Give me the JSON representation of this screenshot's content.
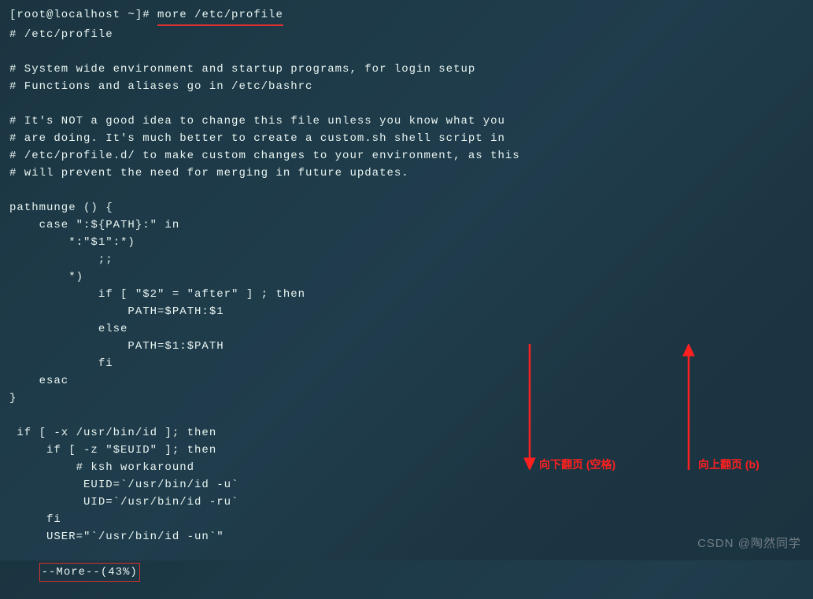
{
  "prompt": {
    "user_host": "[root@localhost ~]# ",
    "command": "more /etc/profile"
  },
  "file_content": {
    "lines": [
      "# /etc/profile",
      "",
      "# System wide environment and startup programs, for login setup",
      "# Functions and aliases go in /etc/bashrc",
      "",
      "# It's NOT a good idea to change this file unless you know what you",
      "# are doing. It's much better to create a custom.sh shell script in",
      "# /etc/profile.d/ to make custom changes to your environment, as this",
      "# will prevent the need for merging in future updates.",
      "",
      "pathmunge () {",
      "    case \":${PATH}:\" in",
      "        *:\"$1\":*)",
      "            ;;",
      "        *)",
      "            if [ \"$2\" = \"after\" ] ; then",
      "                PATH=$PATH:$1",
      "            else",
      "                PATH=$1:$PATH",
      "            fi",
      "    esac",
      "}",
      "",
      " if [ -x /usr/bin/id ]; then",
      "     if [ -z \"$EUID\" ]; then",
      "         # ksh workaround",
      "          EUID=`/usr/bin/id -u`",
      "          UID=`/usr/bin/id -ru`",
      "     fi",
      "     USER=\"`/usr/bin/id -un`\""
    ]
  },
  "more_status": "--More--(43%)",
  "annotations": {
    "down_label": "向下翻页 (空格)",
    "up_label": "向上翻页 (b)"
  },
  "watermark": "CSDN @陶然同学"
}
